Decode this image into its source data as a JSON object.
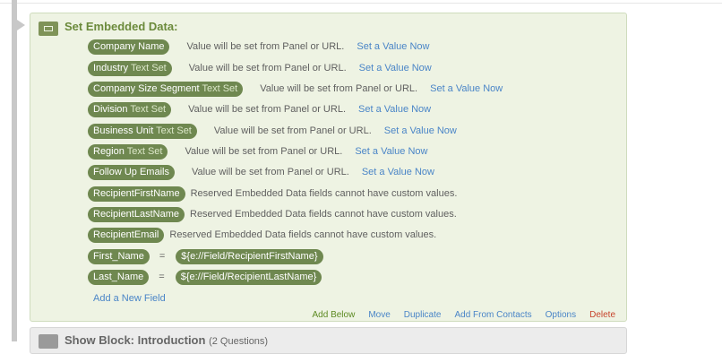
{
  "block": {
    "title": "Set Embedded Data:",
    "fields": [
      {
        "name": "Company Name",
        "tag": "",
        "desc": "Value will be set from Panel or URL.",
        "link": "Set a Value Now"
      },
      {
        "name": "Industry",
        "tag": "Text Set",
        "desc": "Value will be set from Panel or URL.",
        "link": "Set a Value Now"
      },
      {
        "name": "Company Size Segment",
        "tag": "Text Set",
        "desc": "Value will be set from Panel or URL.",
        "link": "Set a Value Now"
      },
      {
        "name": "Division",
        "tag": "Text Set",
        "desc": "Value will be set from Panel or URL.",
        "link": "Set a Value Now"
      },
      {
        "name": "Business Unit",
        "tag": "Text Set",
        "desc": "Value will be set from Panel or URL.",
        "link": "Set a Value Now"
      },
      {
        "name": "Region",
        "tag": "Text Set",
        "desc": "Value will be set from Panel or URL.",
        "link": "Set a Value Now"
      },
      {
        "name": "Follow Up Emails",
        "tag": "",
        "desc": "Value will be set from Panel or URL.",
        "link": "Set a Value Now"
      }
    ],
    "reserved": [
      {
        "name": "RecipientFirstName",
        "desc": "Reserved Embedded Data fields cannot have custom values."
      },
      {
        "name": "RecipientLastName",
        "desc": "Reserved Embedded Data fields cannot have custom values."
      },
      {
        "name": "RecipientEmail",
        "desc": "Reserved Embedded Data fields cannot have custom values."
      }
    ],
    "assigned": [
      {
        "name": "First_Name",
        "eq": "=",
        "value": "${e://Field/RecipientFirstName}"
      },
      {
        "name": "Last_Name",
        "eq": "=",
        "value": "${e://Field/RecipientLastName}"
      }
    ],
    "add_field": "Add a New Field",
    "actions": {
      "add_below": "Add Below",
      "move": "Move",
      "duplicate": "Duplicate",
      "add_from_contacts": "Add From Contacts",
      "options": "Options",
      "delete": "Delete"
    }
  },
  "next_block": {
    "title": "Show Block: Introduction",
    "count": "(2 Questions)"
  },
  "colors": {
    "block_bg": "#eef3e3",
    "pill": "#6f8850",
    "link": "#4a85c7",
    "delete": "#c7432b",
    "add_below": "#5d8a22"
  }
}
